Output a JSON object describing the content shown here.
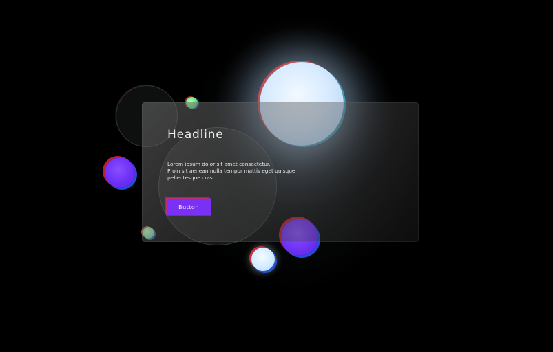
{
  "card": {
    "headline": "Headline",
    "body_lines": [
      "Lorem ipsum dolor sit amet consectetur.",
      "Proin sit aenean nulla tempor mattis eget quisque",
      " pellentesque cras."
    ],
    "button_label": "Button"
  },
  "colors": {
    "background": "#000000",
    "accent_button": "#7a30f5",
    "orb_purple": "#6a2df5",
    "orb_light": "#d8ebff",
    "orb_green": "#5ee07a"
  }
}
